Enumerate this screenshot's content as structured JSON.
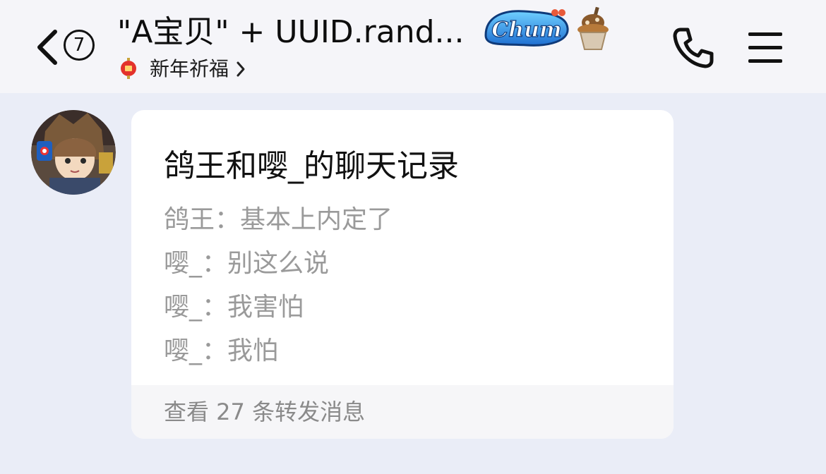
{
  "header": {
    "back_icon": "chevron-left-icon",
    "unread_count": "7",
    "title": "\"A宝贝\" + UUID.rand...",
    "badge_icon": "chum-badge-icon",
    "decor_icon": "ice-cream-icon",
    "group_tag_icon": "lantern-icon",
    "group_tag": "新年祈福",
    "phone_icon": "phone-icon",
    "menu_icon": "hamburger-menu-icon"
  },
  "message": {
    "avatar_icon": "anime-avatar",
    "forward_card": {
      "title": "鸽王和嘤_的聊天记录",
      "lines": [
        "鸽王：基本上内定了",
        "嘤_：别这么说",
        "嘤_：我害怕",
        "嘤_：我怕"
      ],
      "footer": "查看 27 条转发消息"
    }
  },
  "colors": {
    "background": "#eaedf7",
    "header_bg": "#f5f5f9",
    "card_bg": "#ffffff",
    "preview_text": "#9a9a9a",
    "badge_blue": "#3a8ee0",
    "lantern_red": "#e3322b"
  }
}
